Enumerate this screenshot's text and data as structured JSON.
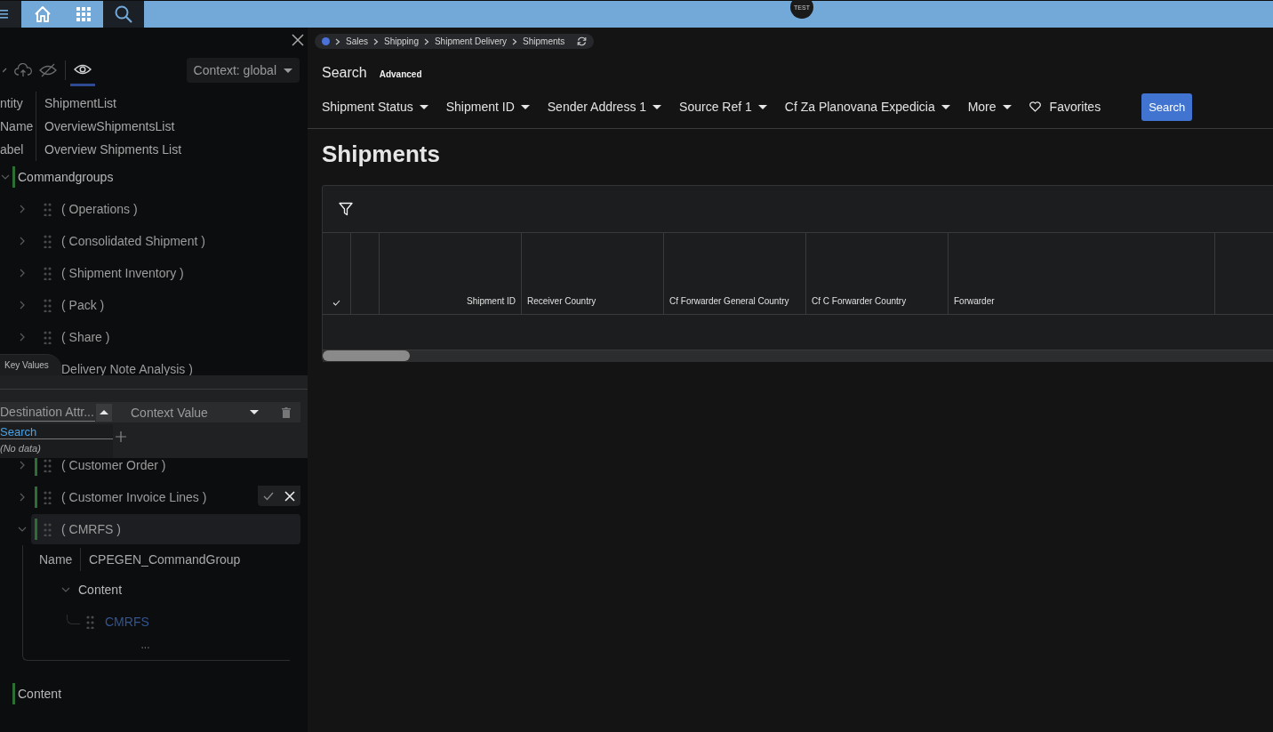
{
  "top_bar": {
    "tiles": [
      {
        "kind": "home",
        "selected": false
      },
      {
        "kind": "apps",
        "selected": false
      },
      {
        "kind": "search",
        "selected": true
      }
    ],
    "logo": "TEST"
  },
  "editor_panel": {
    "tools": [
      {
        "kind": "collapse",
        "selected": false
      },
      {
        "kind": "upload",
        "selected": false
      },
      {
        "kind": "hide",
        "selected": false
      },
      {
        "kind": "preview",
        "selected": true
      }
    ],
    "context_dropdown": "Context: global",
    "properties": [
      {
        "label": "ntity",
        "value": "ShipmentList"
      },
      {
        "label": "Name",
        "value": "OverviewShipmentsList"
      },
      {
        "label": "abel",
        "value": "Overview Shipments List"
      }
    ],
    "tree": [
      {
        "kind": "section",
        "label": "Commandgroups",
        "expanded": true,
        "marked": true,
        "children": [
          {
            "kind": "group",
            "label": "( Operations )",
            "expanded": false,
            "marked": false,
            "selected": false
          },
          {
            "kind": "group",
            "label": "( Consolidated Shipment )",
            "expanded": false,
            "marked": false,
            "selected": false
          },
          {
            "kind": "group",
            "label": "( Shipment Inventory )",
            "expanded": false,
            "marked": false,
            "selected": false
          },
          {
            "kind": "group",
            "label": "( Pack )",
            "expanded": false,
            "marked": false,
            "selected": false
          },
          {
            "kind": "group",
            "label": "( Share )",
            "expanded": false,
            "marked": false,
            "selected": false
          },
          {
            "kind": "group",
            "label": "Delivery Note Analysis )",
            "selected": false
          }
        ],
        "children_below_popup": [
          {
            "kind": "group",
            "label": "( Customer Order )",
            "expanded": false,
            "marked": true,
            "selected": false
          },
          {
            "kind": "group",
            "label": "( Customer Invoice Lines )",
            "expanded": false,
            "marked": true,
            "selected": false
          },
          {
            "kind": "group",
            "label": "( CMRFS )",
            "expanded": true,
            "marked": true,
            "selected": true,
            "properties": [
              {
                "label": "Name",
                "value": "CPEGEN_CommandGroup"
              }
            ],
            "children": [
              {
                "kind": "section",
                "label": "Content",
                "expanded": true,
                "children": [
                  {
                    "kind": "link",
                    "label": "CMRFS"
                  }
                ]
              }
            ],
            "more": "..."
          }
        ]
      },
      {
        "kind": "section",
        "label": "Content",
        "marked": true
      }
    ]
  },
  "key_values_popup": {
    "tab": "Key Values",
    "columns": [
      {
        "label": "Destination Attr...",
        "descending": false
      },
      {
        "label": "Context Value",
        "descending": true
      }
    ],
    "search_placeholder": "Search",
    "empty_text": "(No data)"
  },
  "main": {
    "breadcrumb": [
      "Sales",
      "Shipping",
      "Shipment Delivery",
      "Shipments"
    ],
    "search": {
      "title": "Search",
      "advanced": "Advanced",
      "filters": [
        {
          "kind": "dropdown",
          "label": "Shipment Status"
        },
        {
          "kind": "dropdown",
          "label": "Shipment ID"
        },
        {
          "kind": "dropdown",
          "label": "Sender Address 1"
        },
        {
          "kind": "dropdown",
          "label": "Source Ref 1"
        },
        {
          "kind": "dropdown",
          "label": "Cf Za Planovana Expedicia"
        },
        {
          "kind": "dropdown",
          "label": "More"
        },
        {
          "kind": "favorites",
          "label": "Favorites"
        }
      ],
      "button": "Search"
    },
    "page_title": "Shipments",
    "table": {
      "columns": [
        {
          "kind": "select"
        },
        {
          "kind": "spacer"
        },
        {
          "kind": "id",
          "label": "Shipment ID"
        },
        {
          "kind": "text",
          "label": "Receiver Country"
        },
        {
          "kind": "text",
          "label": "Cf Forwarder General Country"
        },
        {
          "kind": "text",
          "label": "Cf C Forwarder Country"
        },
        {
          "kind": "text",
          "label": "Forwarder"
        }
      ]
    }
  }
}
